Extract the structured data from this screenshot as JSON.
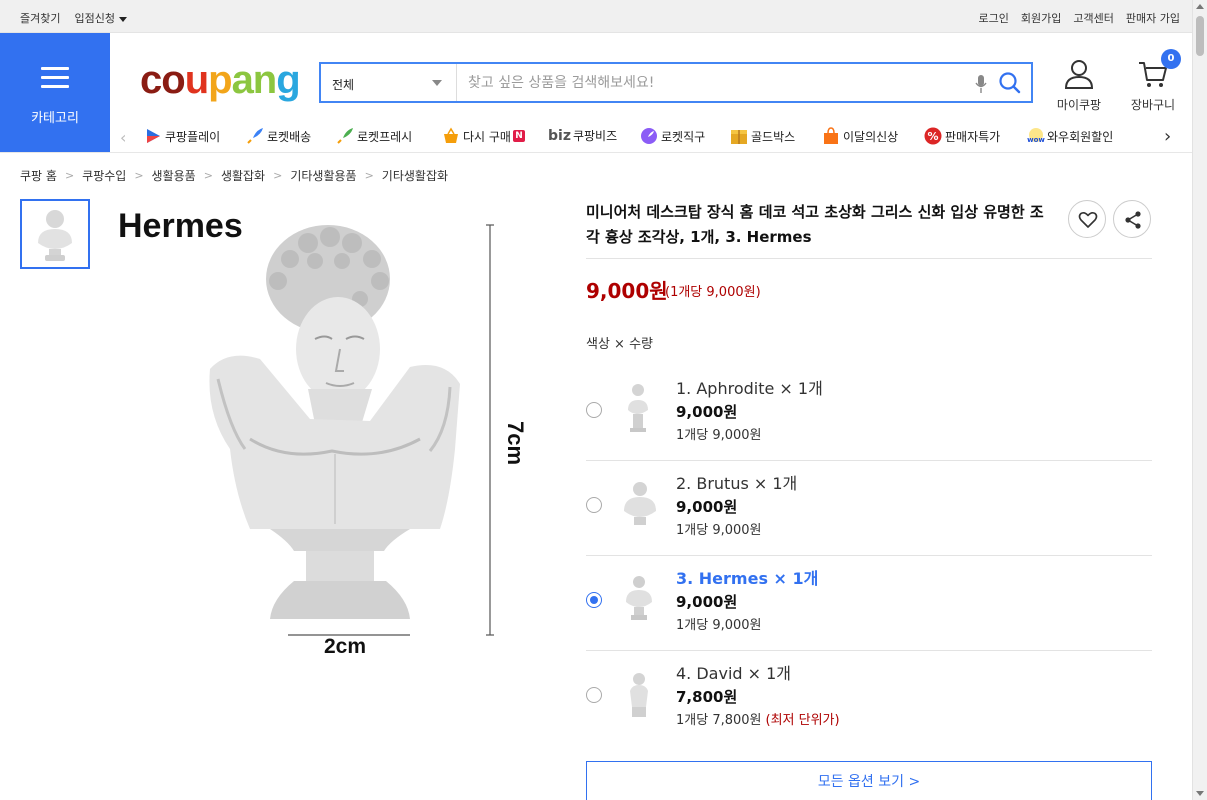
{
  "topbar": {
    "left": [
      "즐겨찾기",
      "입점신청"
    ],
    "right": [
      "로그인",
      "회원가입",
      "고객센터",
      "판매자 가입"
    ]
  },
  "header": {
    "category_label": "카테고리",
    "logo": [
      "co",
      "u",
      "p",
      "an",
      "g"
    ],
    "search": {
      "category": "전체",
      "placeholder": "찾고 싶은 상품을 검색해보세요!"
    },
    "mycoupang_label": "마이쿠팡",
    "cart_label": "장바구니",
    "cart_count": "0"
  },
  "subnav": {
    "items": [
      {
        "label": "쿠팡플레이",
        "icon": "play-icon",
        "color": "#2b6de0"
      },
      {
        "label": "로켓배송",
        "icon": "rocket-icon",
        "color": "#3b82f6"
      },
      {
        "label": "로켓프레시",
        "icon": "rocket-fresh-icon",
        "color": "#4caf50"
      },
      {
        "label": "다시 구매",
        "icon": "basket-icon",
        "color": "#f59e0b",
        "badge": "N"
      },
      {
        "label": "쿠팡비즈",
        "icon": "biz-icon",
        "prefix": "biz",
        "color": "#444"
      },
      {
        "label": "로켓직구",
        "icon": "rocket-global-icon",
        "color": "#8b5cf6"
      },
      {
        "label": "골드박스",
        "icon": "goldbox-icon",
        "color": "#e5a823"
      },
      {
        "label": "이달의신상",
        "icon": "new-bag-icon",
        "color": "#f97316"
      },
      {
        "label": "판매자특가",
        "icon": "percent-icon",
        "color": "#dc2626"
      },
      {
        "label": "와우회원할인",
        "icon": "wow-icon",
        "color": "#e11d48"
      }
    ]
  },
  "breadcrumb": [
    "쿠팡 홈",
    "쿠팡수입",
    "생활용품",
    "생활잡화",
    "기타생활용품",
    "기타생활잡화"
  ],
  "gallery": {
    "image_title": "Hermes",
    "height_label": "7cm",
    "width_label": "2cm"
  },
  "product": {
    "title": "미니어처 데스크탑 장식 홈 데코 석고 초상화 그리스 신화 입상 유명한 조각 흉상 조각상, 1개, 3. Hermes",
    "price": "9,000원",
    "unit_price": "(1개당 9,000원)",
    "option_header": "색상 × 수량",
    "options": [
      {
        "name": "1. Aphrodite × 1개",
        "price": "9,000원",
        "unit": "1개당 9,000원",
        "note": "",
        "selected": false
      },
      {
        "name": "2. Brutus × 1개",
        "price": "9,000원",
        "unit": "1개당 9,000원",
        "note": "",
        "selected": false
      },
      {
        "name": "3. Hermes × 1개",
        "price": "9,000원",
        "unit": "1개당 9,000원",
        "note": "",
        "selected": true
      },
      {
        "name": "4. David × 1개",
        "price": "7,800원",
        "unit": "1개당 7,800원",
        "note": "(최저 단위가)",
        "selected": false
      }
    ],
    "all_options_label": "모든 옵션 보기 >"
  }
}
